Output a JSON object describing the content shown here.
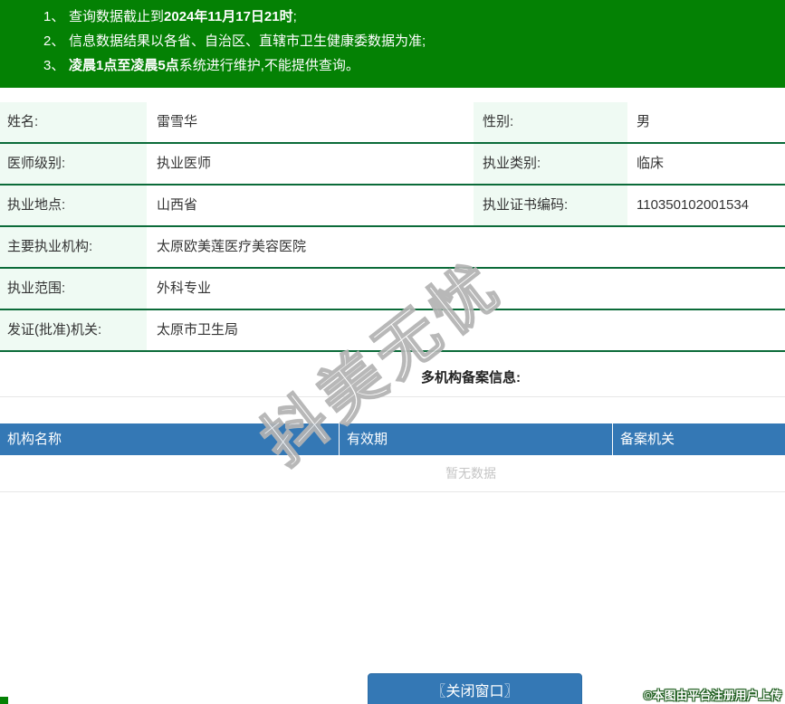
{
  "notice": {
    "bg_color": "#048104",
    "lines": [
      {
        "num": "1、",
        "pre": "查询数据截止到",
        "bold": "2024年11月17日21时",
        "post": ";"
      },
      {
        "num": "2、",
        "pre": "信息数据结果以各省、自治区、直辖市卫生健康委数据为准;",
        "bold": "",
        "post": ""
      },
      {
        "num": "3、",
        "pre": "",
        "bold": "凌晨1点至凌晨5点",
        "post": "系统进行维护,不能提供查询。"
      }
    ]
  },
  "profile": {
    "rows": [
      {
        "label": "姓名:",
        "value": "雷雪华",
        "label2": "性别:",
        "value2": "男"
      },
      {
        "label": "医师级别:",
        "value": "执业医师",
        "label2": "执业类别:",
        "value2": "临床"
      },
      {
        "label": "执业地点:",
        "value": "山西省",
        "label2": "执业证书编码:",
        "value2": "110350102001534"
      },
      {
        "label": "主要执业机构:",
        "value": "太原欧美莲医疗美容医院"
      },
      {
        "label": "执业范围:",
        "value": "外科专业"
      },
      {
        "label": "发证(批准)机关:",
        "value": "太原市卫生局"
      }
    ],
    "label_bg_color": "#effaf3",
    "row_border_color": "#0b6b39"
  },
  "records": {
    "heading": "多机构备案信息:",
    "columns": [
      "机构名称",
      "有效期",
      "备案机关"
    ],
    "header_bg_color": "#3478b5",
    "empty_text": "暂无数据"
  },
  "watermark_text": "抖美无忧",
  "footer": {
    "close_button_label": "〖关闭窗口〗",
    "copyright_text": "©本图由平台注册用户上传"
  }
}
